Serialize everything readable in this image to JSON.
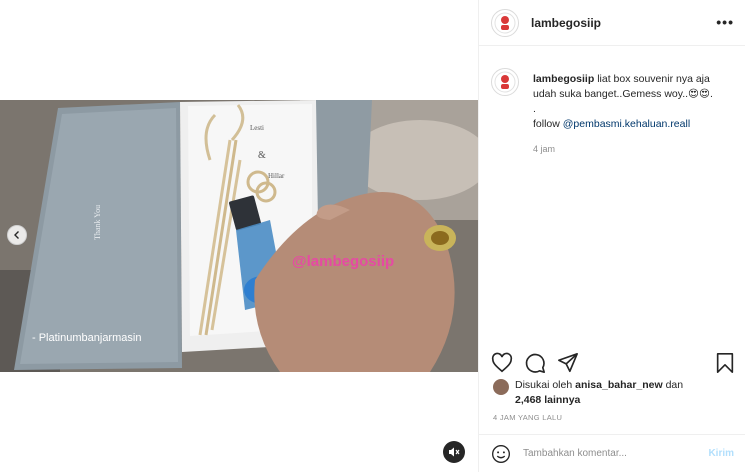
{
  "post": {
    "username": "lambegosiip",
    "watermark": "@lambegosiip",
    "video_text": {
      "overlay_caption": "- Platinumbanjarmasin",
      "card_name_1": "Lesti",
      "card_amp": "&",
      "card_name_2": "Hillar",
      "box_text": "Thank You"
    }
  },
  "caption": {
    "username": "lambegosiip",
    "text": "liat box souvenir nya aja udah suka banget..Gemess woy..😍😍.",
    "dot": ".",
    "follow_prefix": "follow ",
    "follow_link": "@pembasmi.kehaluan.reall",
    "time": "4 jam"
  },
  "likes": {
    "prefix": "Disukai oleh ",
    "user": "anisa_bahar_new",
    "middle": " dan",
    "count": "2,468 lainnya"
  },
  "posted_time": "4 JAM YANG LALU",
  "comment": {
    "placeholder": "Tambahkan komentar...",
    "post_label": "Kirim"
  },
  "icons": {
    "more": "more-options-icon",
    "like": "heart-icon",
    "comment": "comment-bubble-icon",
    "share": "paper-plane-icon",
    "save": "bookmark-icon",
    "emoji": "smiley-icon",
    "mute": "muted-speaker-icon",
    "prev": "chevron-left-icon"
  },
  "colors": {
    "link": "#00376b",
    "post_button": "#b2dffc",
    "muted_text": "#8e8e8e",
    "watermark": "#e64aa3"
  }
}
